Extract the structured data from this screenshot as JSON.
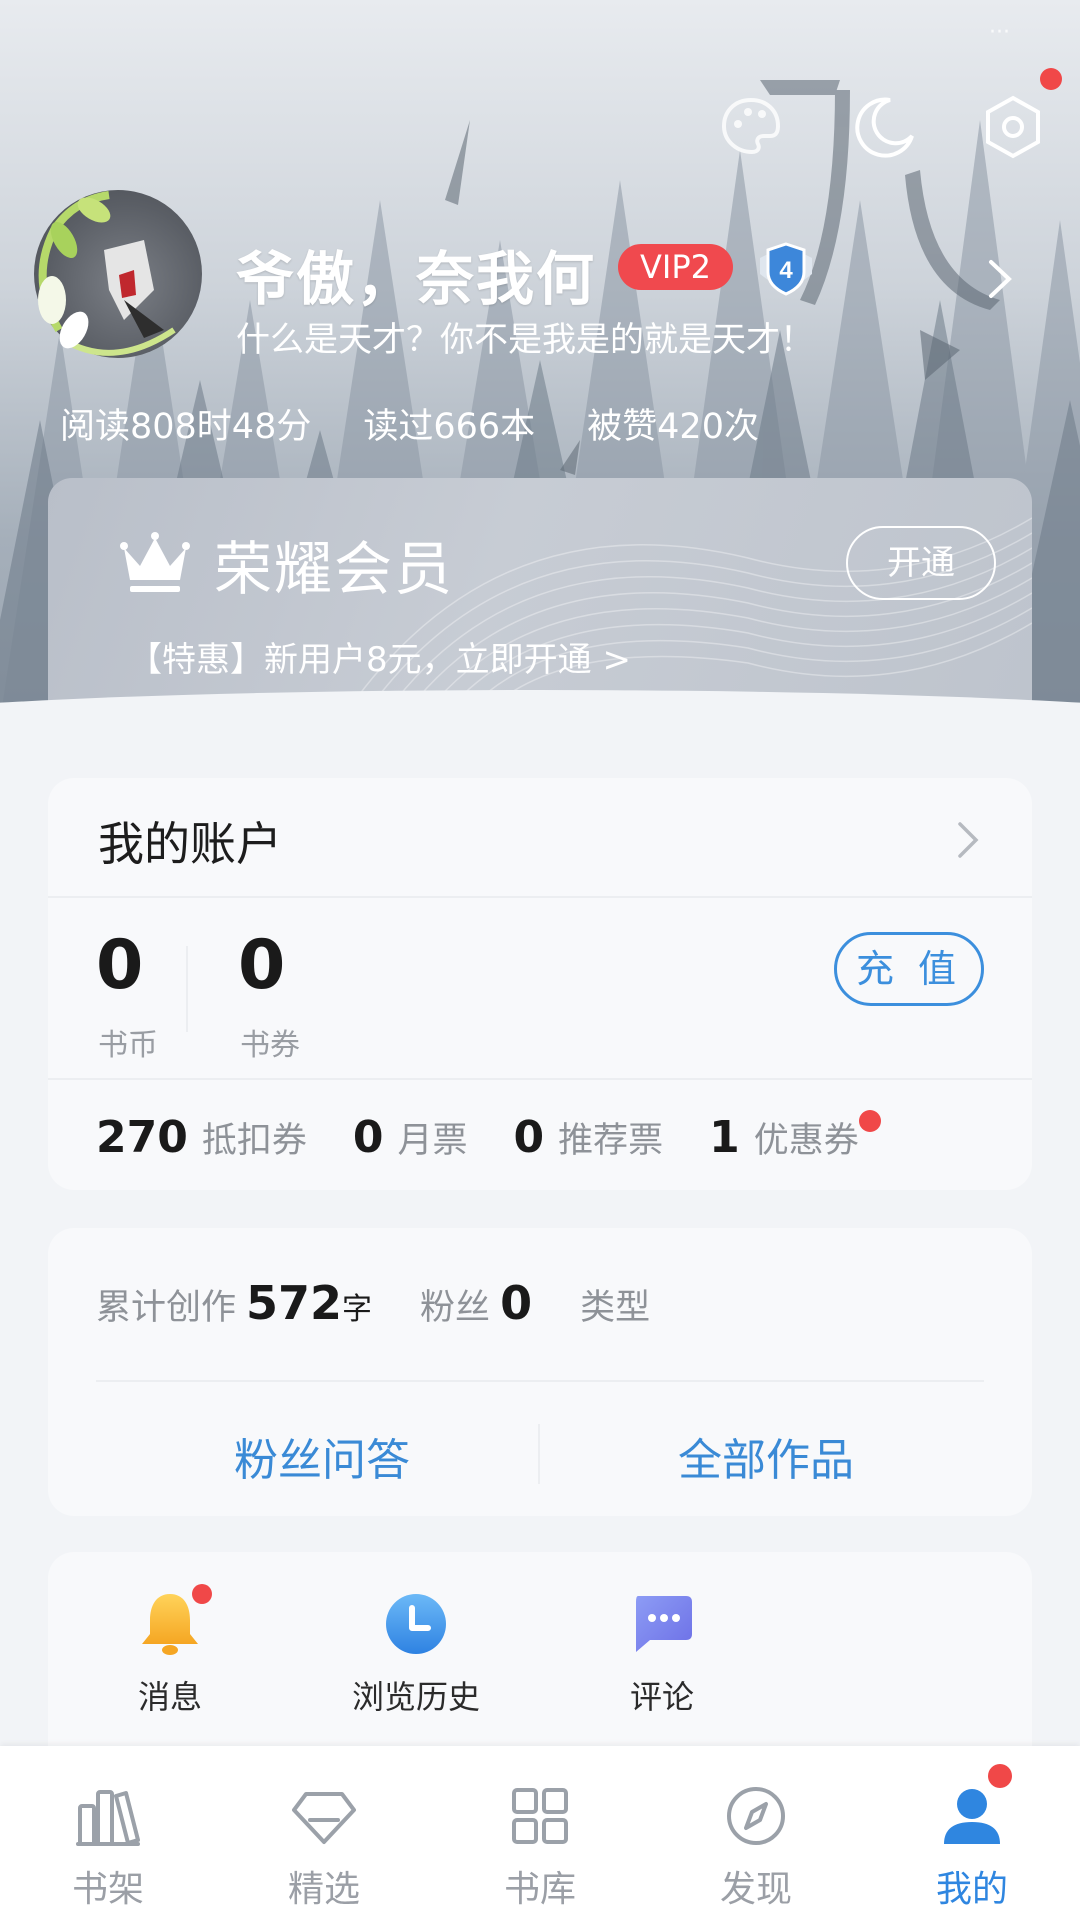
{
  "header": {
    "nickname": "爷傲，奈我何",
    "vip_badge": "VIP2",
    "level_badge": "4",
    "signature": "什么是天才？你不是我是的就是天才！",
    "stats": [
      "阅读808时48分",
      "读过666本",
      "被赞420次"
    ],
    "top_icons": [
      "skin-icon",
      "night-mode-icon",
      "settings-icon"
    ]
  },
  "vip_card": {
    "title": "荣耀会员",
    "button": "开通",
    "promo": "【特惠】新用户8元，立即开通 >"
  },
  "account": {
    "title": "我的账户",
    "coins_value": "0",
    "coins_label": "书币",
    "vouchers_value": "0",
    "vouchers_label": "书券",
    "recharge_label": "充 值",
    "tickets": [
      {
        "value": "270",
        "label": "抵扣券"
      },
      {
        "value": "0",
        "label": "月票"
      },
      {
        "value": "0",
        "label": "推荐票"
      },
      {
        "value": "1",
        "label": "优惠券"
      }
    ]
  },
  "creation": {
    "words_label": "累计创作",
    "words_value": "572",
    "words_unit": "字",
    "fans_label": "粉丝",
    "fans_value": "0",
    "type_label": "类型",
    "fans_qa": "粉丝问答",
    "all_works": "全部作品"
  },
  "tools": [
    {
      "label": "消息",
      "icon": "bell-icon"
    },
    {
      "label": "浏览历史",
      "icon": "clock-icon"
    },
    {
      "label": "评论",
      "icon": "comment-icon"
    }
  ],
  "bottom_nav": [
    {
      "label": "书架",
      "icon": "bookshelf-icon"
    },
    {
      "label": "精选",
      "icon": "diamond-icon"
    },
    {
      "label": "书库",
      "icon": "grid-icon"
    },
    {
      "label": "发现",
      "icon": "compass-icon"
    },
    {
      "label": "我的",
      "icon": "profile-icon"
    }
  ],
  "colors": {
    "accent": "#2f86e0",
    "badge_red": "#f04848",
    "link_blue": "#3a8ad6"
  }
}
